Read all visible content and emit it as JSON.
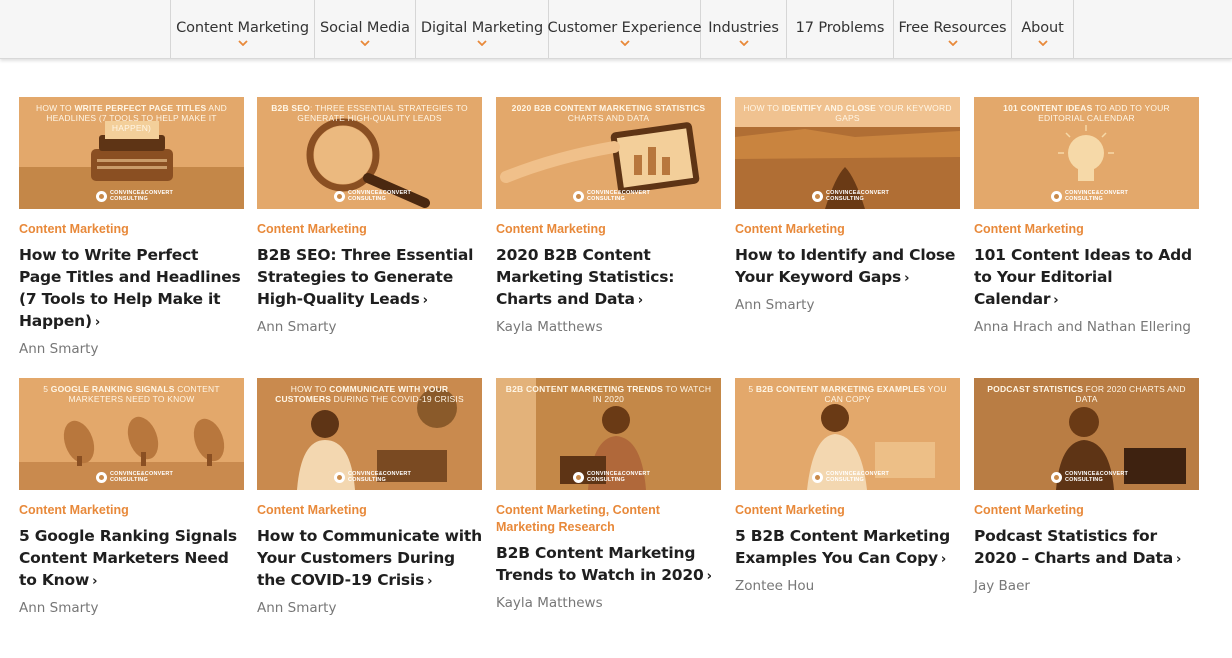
{
  "nav": {
    "items": [
      {
        "label": "Content Marketing",
        "has_menu": true
      },
      {
        "label": "Social Media",
        "has_menu": true
      },
      {
        "label": "Digital Marketing",
        "has_menu": true
      },
      {
        "label": "Customer Experience",
        "has_menu": true
      },
      {
        "label": "Industries",
        "has_menu": true
      },
      {
        "label": "17 Problems",
        "has_menu": false
      },
      {
        "label": "Free Resources",
        "has_menu": true
      },
      {
        "label": "About",
        "has_menu": true
      }
    ],
    "caret_color": "#e8893a"
  },
  "brand": {
    "logo_text_1": "CONVINCE&CONVERT",
    "logo_text_2": "CONSULTING"
  },
  "colors": {
    "category": "#e8893a",
    "thumb_tint": "#e3a86b"
  },
  "posts": [
    {
      "image_caption_light": "How to ",
      "image_caption_bold": "write perfect page titles",
      "image_caption_rest": " and headlines (7 tools to help make it happen)",
      "image_subject": "typewriter-image",
      "category": "Content Marketing",
      "title": "How to Write Perfect Page Titles and Headlines (7 Tools to Help Make it Happen)",
      "author": "Ann Smarty"
    },
    {
      "image_caption_light": "",
      "image_caption_bold": "B2B SEO",
      "image_caption_rest": ": three essential strategies to generate high-quality leads",
      "image_subject": "magnifying-glass-image",
      "category": "Content Marketing",
      "title": "B2B SEO: Three Essential Strategies to Generate High-Quality Leads",
      "author": "Ann Smarty"
    },
    {
      "image_caption_light": "",
      "image_caption_bold": "2020 B2B content marketing statistics",
      "image_caption_rest": " charts and data",
      "image_subject": "tablet-chart-image",
      "category": "Content Marketing",
      "title": "2020 B2B Content Marketing Statistics: Charts and Data",
      "author": "Kayla Matthews"
    },
    {
      "image_caption_light": "How to ",
      "image_caption_bold": "identify and close",
      "image_caption_rest": " your keyword gaps",
      "image_subject": "canyon-image",
      "category": "Content Marketing",
      "title": "How to Identify and Close Your Keyword Gaps",
      "author": "Ann Smarty"
    },
    {
      "image_caption_light": "",
      "image_caption_bold": "101 content ideas",
      "image_caption_rest": " to add to your editorial calendar",
      "image_subject": "lightbulb-image",
      "category": "Content Marketing",
      "title": "101 Content Ideas to Add to Your Editorial Calendar",
      "author": "Anna Hrach and Nathan Ellering"
    },
    {
      "image_caption_light": "5 ",
      "image_caption_bold": "Google ranking signals",
      "image_caption_rest": " content marketers need to know",
      "image_subject": "satellite-dishes-image",
      "category": "Content Marketing",
      "title": "5 Google Ranking Signals Content Marketers Need to Know",
      "author": "Ann Smarty"
    },
    {
      "image_caption_light": "How to ",
      "image_caption_bold": "communicate with your customers",
      "image_caption_rest": " during the COVID-19 crisis",
      "image_subject": "woman-laptop-image",
      "category": "Content Marketing",
      "title": "How to Communicate with Your Customers During the COVID-19 Crisis",
      "author": "Ann Smarty"
    },
    {
      "image_caption_light": "",
      "image_caption_bold": "B2B content marketing trends",
      "image_caption_rest": " to watch in 2020",
      "image_subject": "woman-coffee-image",
      "category": "Content Marketing, Content Marketing Research",
      "title": "B2B Content Marketing Trends to Watch in 2020",
      "author": "Kayla Matthews"
    },
    {
      "image_caption_light": "5 ",
      "image_caption_bold": "B2B content marketing examples",
      "image_caption_rest": " you can copy",
      "image_subject": "woman-writing-image",
      "category": "Content Marketing",
      "title": "5 B2B Content Marketing Examples You Can Copy",
      "author": "Zontee Hou"
    },
    {
      "image_caption_light": "",
      "image_caption_bold": "Podcast statistics",
      "image_caption_rest": " for 2020 charts and data",
      "image_subject": "man-headphones-image",
      "category": "Content Marketing",
      "title": "Podcast Statistics for 2020 – Charts and Data",
      "author": "Jay Baer"
    }
  ]
}
